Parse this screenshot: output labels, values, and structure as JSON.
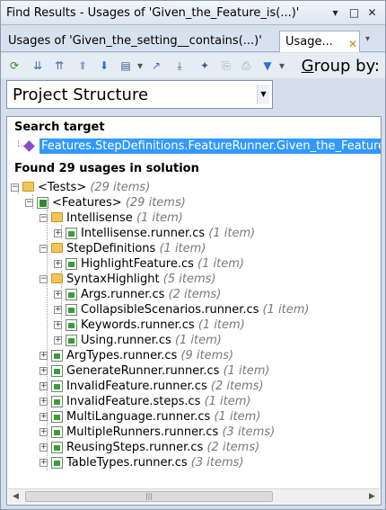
{
  "window": {
    "title": "Find Results - Usages of 'Given_the_Feature_is(...)'",
    "controls": {
      "dropdown": "▾",
      "maximize": "□",
      "close": "✕"
    }
  },
  "tabs": [
    {
      "label": "Usages of 'Given_the_setting__contains(...)'",
      "active": false
    },
    {
      "label": "Usage...",
      "active": true
    }
  ],
  "toolbar": {
    "icons": [
      "refresh-icon",
      "expand-all-icon",
      "collapse-all-icon",
      "previous-icon",
      "next-icon",
      "view-icon",
      "open-icon",
      "export-icon",
      "filter-icon"
    ],
    "group_by_prefix": "G",
    "group_by_rest": "roup by:"
  },
  "group_select": {
    "value": "Project Structure"
  },
  "search_target": {
    "heading": "Search target",
    "value": "Features.StepDefinitions.FeatureRunner.Given_the_Feature_is"
  },
  "results": {
    "heading": "Found 29 usages in solution",
    "tree": [
      {
        "label": "<Tests>",
        "count": "(29 items)",
        "kind": "folder"
      },
      {
        "label": "<Features>",
        "count": "(29 items)",
        "kind": "project"
      },
      {
        "label": "Intellisense",
        "count": "(1 item)",
        "kind": "folder"
      },
      {
        "label": "Intellisense.runner.cs",
        "count": "(1 item)",
        "kind": "file"
      },
      {
        "label": "StepDefinitions",
        "count": "(1 item)",
        "kind": "folder"
      },
      {
        "label": "HighlightFeature.cs",
        "count": "(1 item)",
        "kind": "file"
      },
      {
        "label": "SyntaxHighlight",
        "count": "(5 items)",
        "kind": "folder"
      },
      {
        "label": "Args.runner.cs",
        "count": "(2 items)",
        "kind": "file"
      },
      {
        "label": "CollapsibleScenarios.runner.cs",
        "count": "(1 item)",
        "kind": "file"
      },
      {
        "label": "Keywords.runner.cs",
        "count": "(1 item)",
        "kind": "file"
      },
      {
        "label": "Using.runner.cs",
        "count": "(1 item)",
        "kind": "file"
      },
      {
        "label": "ArgTypes.runner.cs",
        "count": "(9 items)",
        "kind": "file"
      },
      {
        "label": "GenerateRunner.runner.cs",
        "count": "(1 item)",
        "kind": "file"
      },
      {
        "label": "InvalidFeature.runner.cs",
        "count": "(2 items)",
        "kind": "file"
      },
      {
        "label": "InvalidFeature.steps.cs",
        "count": "(1 item)",
        "kind": "file"
      },
      {
        "label": "MultiLanguage.runner.cs",
        "count": "(1 item)",
        "kind": "file"
      },
      {
        "label": "MultipleRunners.runner.cs",
        "count": "(3 items)",
        "kind": "file"
      },
      {
        "label": "ReusingSteps.runner.cs",
        "count": "(2 items)",
        "kind": "file"
      },
      {
        "label": "TableTypes.runner.cs",
        "count": "(3 items)",
        "kind": "file"
      }
    ]
  },
  "scrollbar": {
    "left": "◀",
    "right": "▶",
    "grip": "|||"
  },
  "colors": {
    "selection": "#3399ff",
    "folder": "#f2c55c",
    "count_text": "#7a7a7a"
  }
}
